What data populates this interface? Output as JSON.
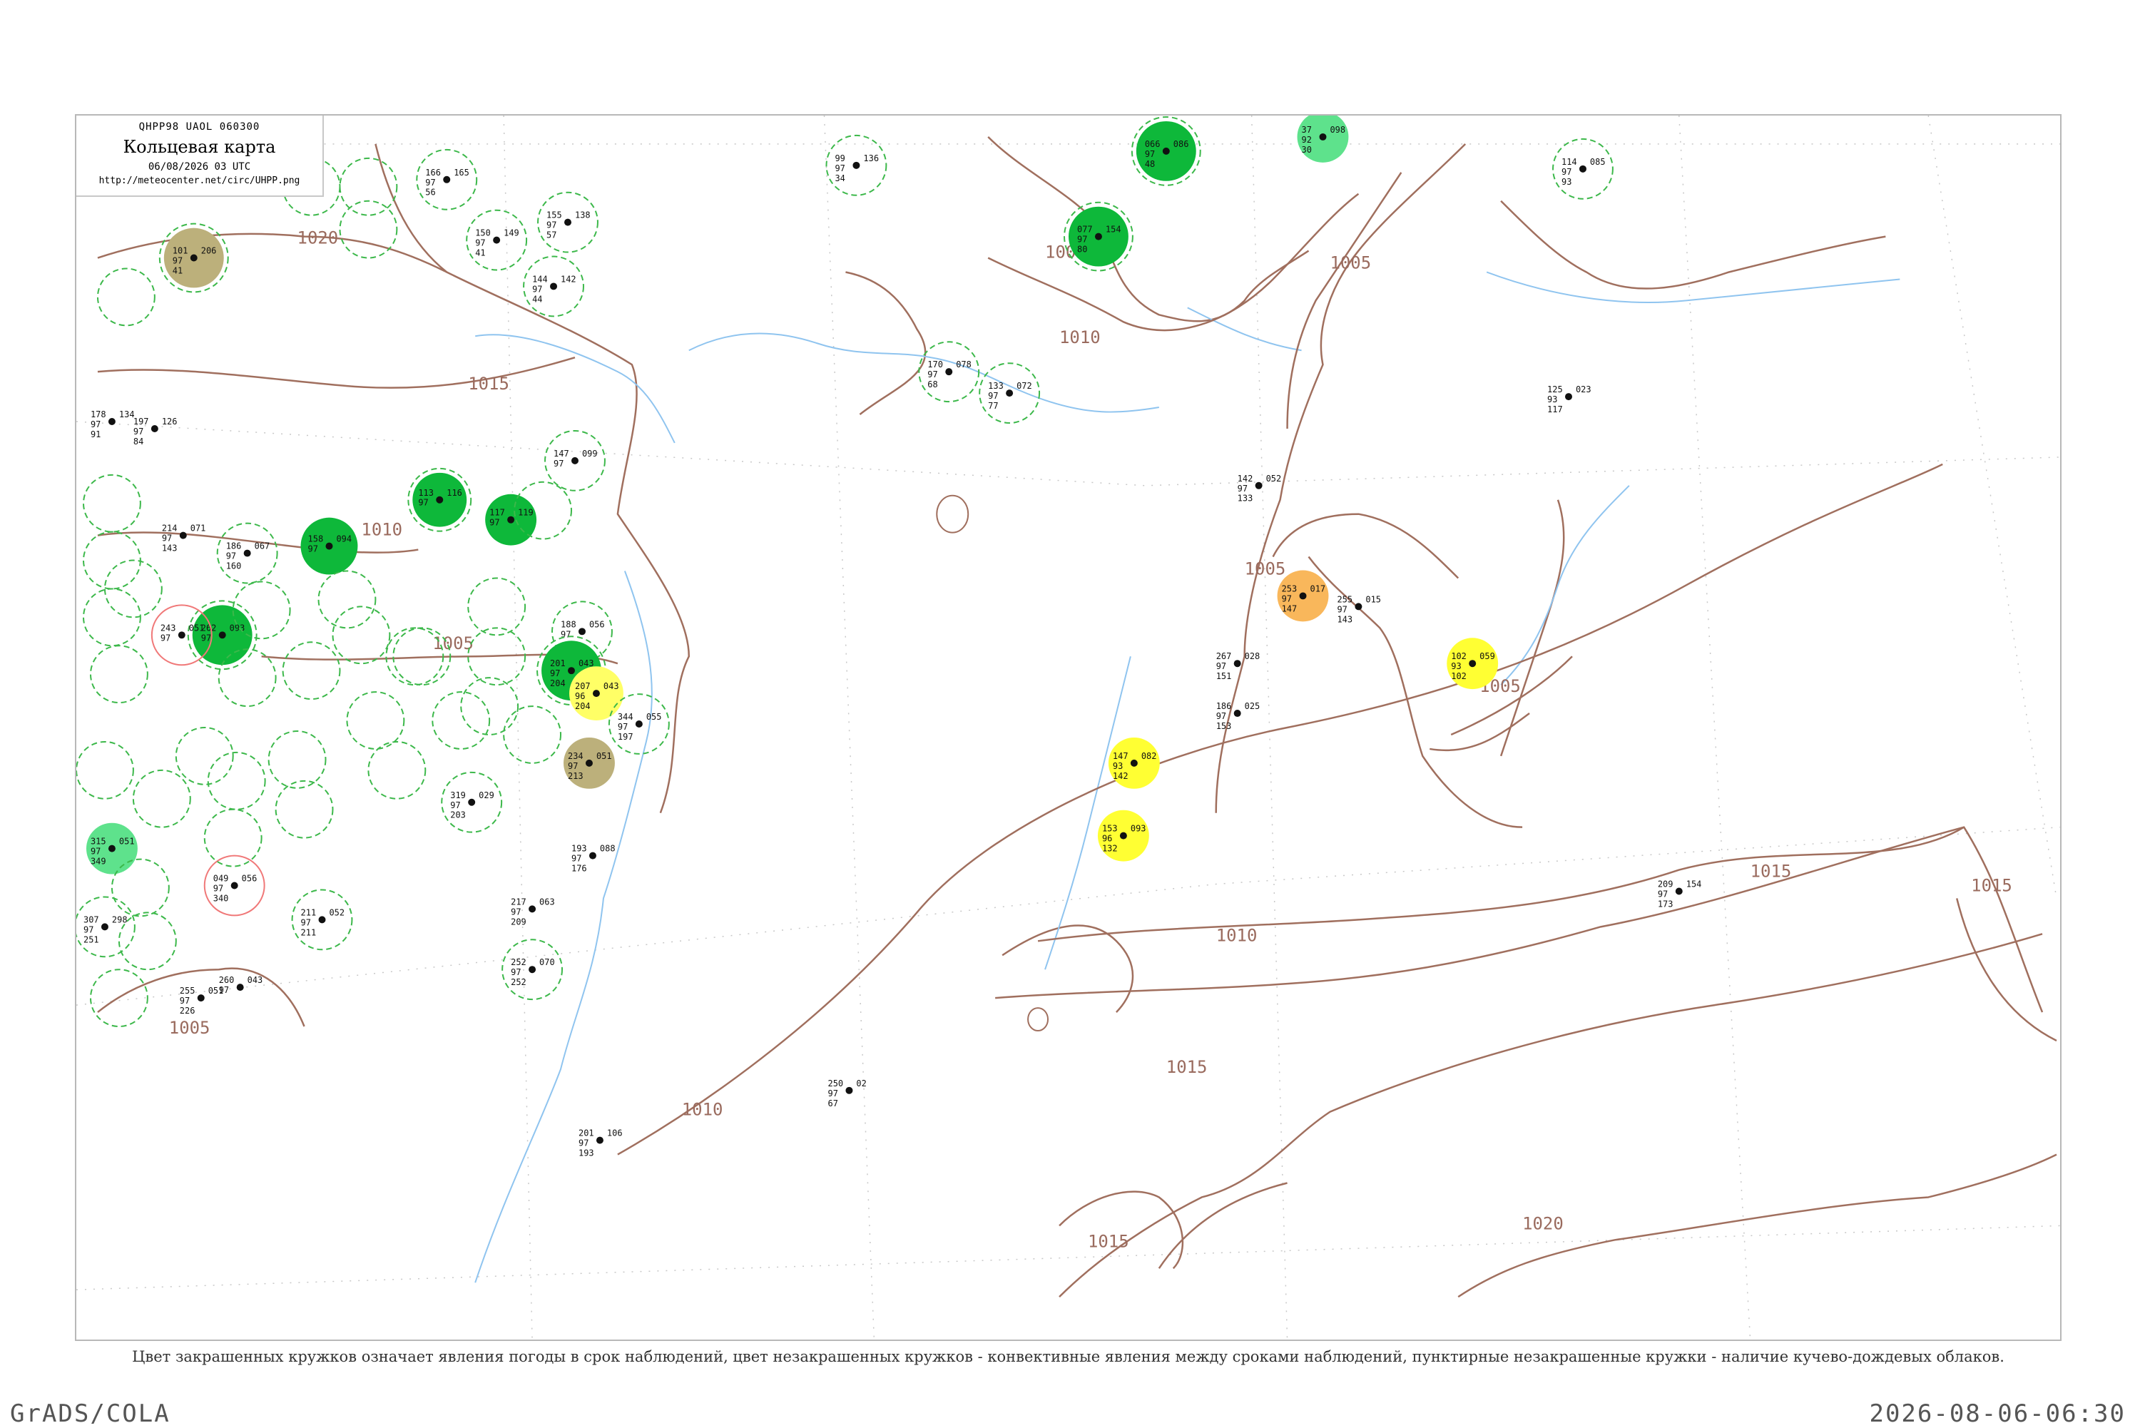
{
  "legend": {
    "code": "QHPP98  UAOL  060300",
    "title": "Кольцевая карта",
    "date": "06/08/2026 03 UTC",
    "url": "http://meteocenter.net/circ/UHPP.png"
  },
  "caption": "Цвет закрашенных кружков означает явления погоды в срок наблюдений, цвет незакрашенных кружков - конвективные явления между сроками наблюдений, пунктирные незакрашенные кружки - наличие кучево-дождевых облаков.",
  "footer": {
    "left": "GrADS/COLA",
    "right": "2026-08-06-06:30"
  },
  "colors": {
    "isobar": "#a06f5e",
    "river": "#8fc4ef",
    "coast": "#a06f5e",
    "grid": "#bdbdbd",
    "green_dark": "#0eb83a",
    "green_light": "#5ee28c",
    "yellow": "#ffff33",
    "orange": "#f9b75b",
    "khaki": "#bcb07b",
    "pink": "#f07878",
    "dashed_ring": "#3cb84a"
  },
  "isobars": [
    {
      "label": "1020"
    },
    {
      "label": "1015"
    },
    {
      "label": "1010"
    },
    {
      "label": "1005"
    },
    {
      "label": "1010"
    },
    {
      "label": "1005"
    },
    {
      "label": "1005"
    },
    {
      "label": "1005"
    },
    {
      "label": "1005"
    },
    {
      "label": "1005"
    },
    {
      "label": "1015"
    },
    {
      "label": "1015"
    },
    {
      "label": "1010"
    },
    {
      "label": "1015"
    },
    {
      "label": "1020"
    },
    {
      "label": "1010"
    },
    {
      "label": "1015"
    }
  ],
  "stations": [
    {
      "top": "101",
      "p": "206",
      "mid": "97",
      "low": "41",
      "fill": "khaki"
    },
    {
      "top": "077",
      "p": "154",
      "mid": "97",
      "low": "80",
      "fill": "green_dark"
    },
    {
      "top": "066",
      "p": "086",
      "mid": "97",
      "low": "48",
      "fill": "green_dark"
    },
    {
      "top": "37",
      "p": "098",
      "mid": "92",
      "low": "30",
      "fill": "green_light"
    },
    {
      "top": "114",
      "p": "085",
      "mid": "97",
      "low": "93",
      "fill": "none"
    },
    {
      "top": "166",
      "p": "165",
      "mid": "97",
      "low": "56",
      "fill": "none"
    },
    {
      "top": "155",
      "p": "138",
      "mid": "97",
      "low": "57",
      "fill": "none"
    },
    {
      "top": "150",
      "p": "149",
      "mid": "97",
      "low": "41",
      "fill": "none"
    },
    {
      "top": "144",
      "p": "142",
      "mid": "97",
      "low": "44",
      "fill": "none"
    },
    {
      "top": "99",
      "p": "136",
      "mid": "97",
      "low": "34",
      "fill": "none"
    },
    {
      "top": "170",
      "p": "078",
      "mid": "97",
      "low": "68",
      "fill": "none"
    },
    {
      "top": "133",
      "p": "072",
      "mid": "97",
      "low": "77",
      "fill": "none"
    },
    {
      "top": "147",
      "p": "099",
      "mid": "97",
      "low": "",
      "fill": "none"
    },
    {
      "top": "113",
      "p": "116",
      "mid": "97",
      "low": "",
      "fill": "green_dark"
    },
    {
      "top": "117",
      "p": "119",
      "mid": "97",
      "low": "",
      "fill": "green_dark"
    },
    {
      "top": "158",
      "p": "094",
      "mid": "97",
      "low": "",
      "fill": "green_dark"
    },
    {
      "top": "262",
      "p": "093",
      "mid": "97",
      "low": "",
      "fill": "green_dark"
    },
    {
      "top": "188",
      "p": "056",
      "mid": "97",
      "low": "",
      "fill": "none"
    },
    {
      "top": "201",
      "p": "043",
      "mid": "97",
      "low": "204",
      "fill": "green_dark"
    },
    {
      "top": "207",
      "p": "043",
      "mid": "96",
      "low": "204",
      "fill": "yellow"
    },
    {
      "top": "234",
      "p": "051",
      "mid": "97",
      "low": "213",
      "fill": "khaki"
    },
    {
      "top": "344",
      "p": "055",
      "mid": "97",
      "low": "197",
      "fill": "none"
    },
    {
      "top": "253",
      "p": "017",
      "mid": "97",
      "low": "147",
      "fill": "orange"
    },
    {
      "top": "102",
      "p": "059",
      "mid": "93",
      "low": "102",
      "fill": "yellow"
    },
    {
      "top": "147",
      "p": "082",
      "mid": "93",
      "low": "142",
      "fill": "yellow"
    },
    {
      "top": "153",
      "p": "093",
      "mid": "96",
      "low": "132",
      "fill": "yellow"
    },
    {
      "top": "315",
      "p": "051",
      "mid": "97",
      "low": "349",
      "fill": "green_light"
    },
    {
      "top": "243",
      "p": "051",
      "mid": "97",
      "low": "",
      "fill": "none"
    },
    {
      "top": "049",
      "p": "056",
      "mid": "97",
      "low": "340",
      "fill": "none"
    },
    {
      "top": "125",
      "p": "023",
      "mid": "93",
      "low": "117",
      "fill": "none"
    },
    {
      "top": "142",
      "p": "052",
      "mid": "97",
      "low": "133",
      "fill": "none"
    },
    {
      "top": "267",
      "p": "028",
      "mid": "97",
      "low": "151",
      "fill": "none"
    },
    {
      "top": "186",
      "p": "025",
      "mid": "97",
      "low": "153",
      "fill": "none"
    },
    {
      "top": "255",
      "p": "015",
      "mid": "97",
      "low": "143",
      "fill": "none"
    },
    {
      "top": "209",
      "p": "154",
      "mid": "97",
      "low": "173",
      "fill": "none"
    },
    {
      "top": "250",
      "p": "02",
      "mid": "97",
      "low": "67",
      "fill": "none"
    },
    {
      "top": "201",
      "p": "106",
      "mid": "97",
      "low": "193",
      "fill": "none"
    },
    {
      "top": "252",
      "p": "070",
      "mid": "97",
      "low": "252",
      "fill": "none"
    },
    {
      "top": "217",
      "p": "063",
      "mid": "97",
      "low": "209",
      "fill": "none"
    },
    {
      "top": "193",
      "p": "088",
      "mid": "97",
      "low": "176",
      "fill": "none"
    },
    {
      "top": "319",
      "p": "029",
      "mid": "97",
      "low": "203",
      "fill": "none"
    },
    {
      "top": "211",
      "p": "052",
      "mid": "97",
      "low": "211",
      "fill": "none"
    },
    {
      "top": "307",
      "p": "298",
      "mid": "97",
      "low": "251",
      "fill": "none"
    },
    {
      "top": "255",
      "p": "051",
      "mid": "97",
      "low": "226",
      "fill": "none"
    },
    {
      "top": "260",
      "p": "043",
      "mid": "97",
      "low": "",
      "fill": "none"
    },
    {
      "top": "178",
      "p": "134",
      "mid": "97",
      "low": "91",
      "fill": "none"
    },
    {
      "top": "197",
      "p": "126",
      "mid": "97",
      "low": "84",
      "fill": "none"
    },
    {
      "top": "214",
      "p": "071",
      "mid": "97",
      "low": "143",
      "fill": "none"
    },
    {
      "top": "186",
      "p": "067",
      "mid": "97",
      "low": "160",
      "fill": "none"
    }
  ]
}
